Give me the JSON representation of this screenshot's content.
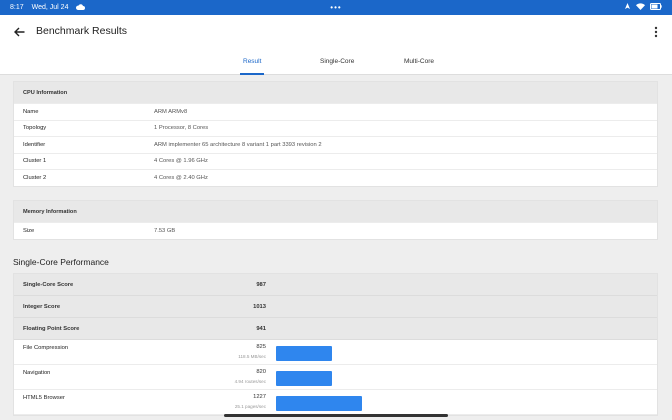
{
  "status_bar": {
    "time": "8:17",
    "date": "Wed, Jul 24",
    "center_dots": "•••"
  },
  "app_bar": {
    "title": "Benchmark Results"
  },
  "tabs": [
    {
      "label": "Result",
      "active": true
    },
    {
      "label": "Single-Core",
      "active": false
    },
    {
      "label": "Multi-Core",
      "active": false
    }
  ],
  "cpu": {
    "header": "CPU Information",
    "rows": [
      {
        "key": "Name",
        "value": "ARM ARMv8"
      },
      {
        "key": "Topology",
        "value": "1 Processor, 8 Cores"
      },
      {
        "key": "Identifier",
        "value": "ARM implementer 65 architecture 8 variant 1 part 3393 revision 2"
      },
      {
        "key": "Cluster 1",
        "value": "4 Cores @ 1.96 GHz"
      },
      {
        "key": "Cluster 2",
        "value": "4 Cores @ 2.40 GHz"
      }
    ]
  },
  "memory": {
    "header": "Memory Information",
    "rows": [
      {
        "key": "Size",
        "value": "7.53 GB"
      }
    ]
  },
  "single_core": {
    "title": "Single-Core Performance",
    "scores": [
      {
        "key": "Single-Core Score",
        "value": "987"
      },
      {
        "key": "Integer Score",
        "value": "1013"
      },
      {
        "key": "Floating Point Score",
        "value": "941"
      }
    ],
    "tests": [
      {
        "key": "File Compression",
        "value": "825",
        "sub": "118.5 MB/sec",
        "bar_fraction": 0.084
      },
      {
        "key": "Navigation",
        "value": "820",
        "sub": "4.94 routes/sec",
        "bar_fraction": 0.084
      },
      {
        "key": "HTML5 Browser",
        "value": "1227",
        "sub": "25.1 pages/sec",
        "bar_fraction": 0.128
      }
    ]
  },
  "colors": {
    "accent": "#1b67c9",
    "bar": "#2f86ee"
  }
}
